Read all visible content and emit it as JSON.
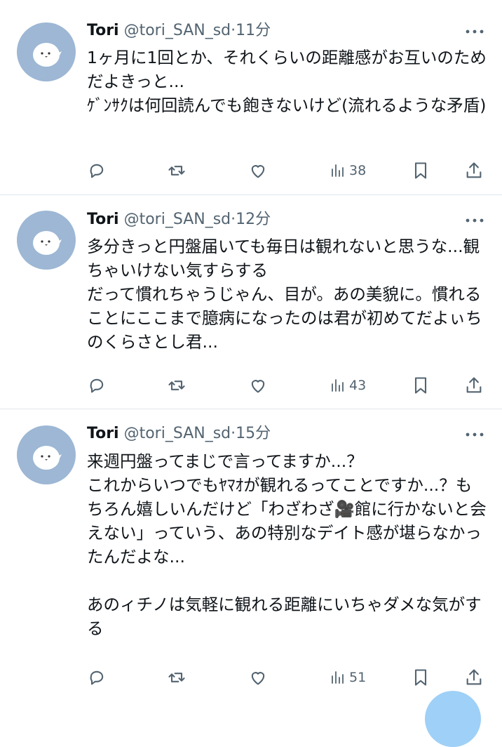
{
  "tweets": [
    {
      "name": "Tori",
      "handle": "@tori_SAN_sd",
      "dot": "·",
      "time": "11分",
      "text": "1ヶ月に1回とか、それくらいの距離感がお互いのためだよきっと...\nｹﾞﾝｻｸは何回読んでも飽きないけど(流れるような矛盾)",
      "views": "38"
    },
    {
      "name": "Tori",
      "handle": "@tori_SAN_sd",
      "dot": "·",
      "time": "12分",
      "text": "多分きっと円盤届いても毎日は観れないと思うな...観ちゃいけない気すらする\nだって慣れちゃうじゃん、目が。あの美貌に。慣れることにここまで臆病になったのは君が初めてだよぃちのくらさとし君...",
      "views": "43"
    },
    {
      "name": "Tori",
      "handle": "@tori_SAN_sd",
      "dot": "·",
      "time": "15分",
      "text": "来週円盤ってまじで言ってますか...？\nこれからいつでもﾔﾏｵが観れるってことですか...？もちろん嬉しいんだけど「わざわざ🎥館に行かないと会えない」っていう、あの特別なデイト感が堪らなかったんだよな...\n\nあのィチノは気軽に観れる距離にいちゃダメな気がする",
      "views": "51"
    }
  ],
  "icons": {
    "avatar": "white-bird-avatar",
    "more": "more-dots-icon",
    "reply": "reply-icon",
    "retweet": "retweet-icon",
    "like": "heart-icon",
    "views": "views-icon",
    "bookmark": "bookmark-icon",
    "share": "share-icon"
  },
  "colors": {
    "avatar_bg": "#9db7d4",
    "muted": "#536471",
    "divider": "#e1e6ea",
    "compose_button": "#9fd0f7"
  }
}
